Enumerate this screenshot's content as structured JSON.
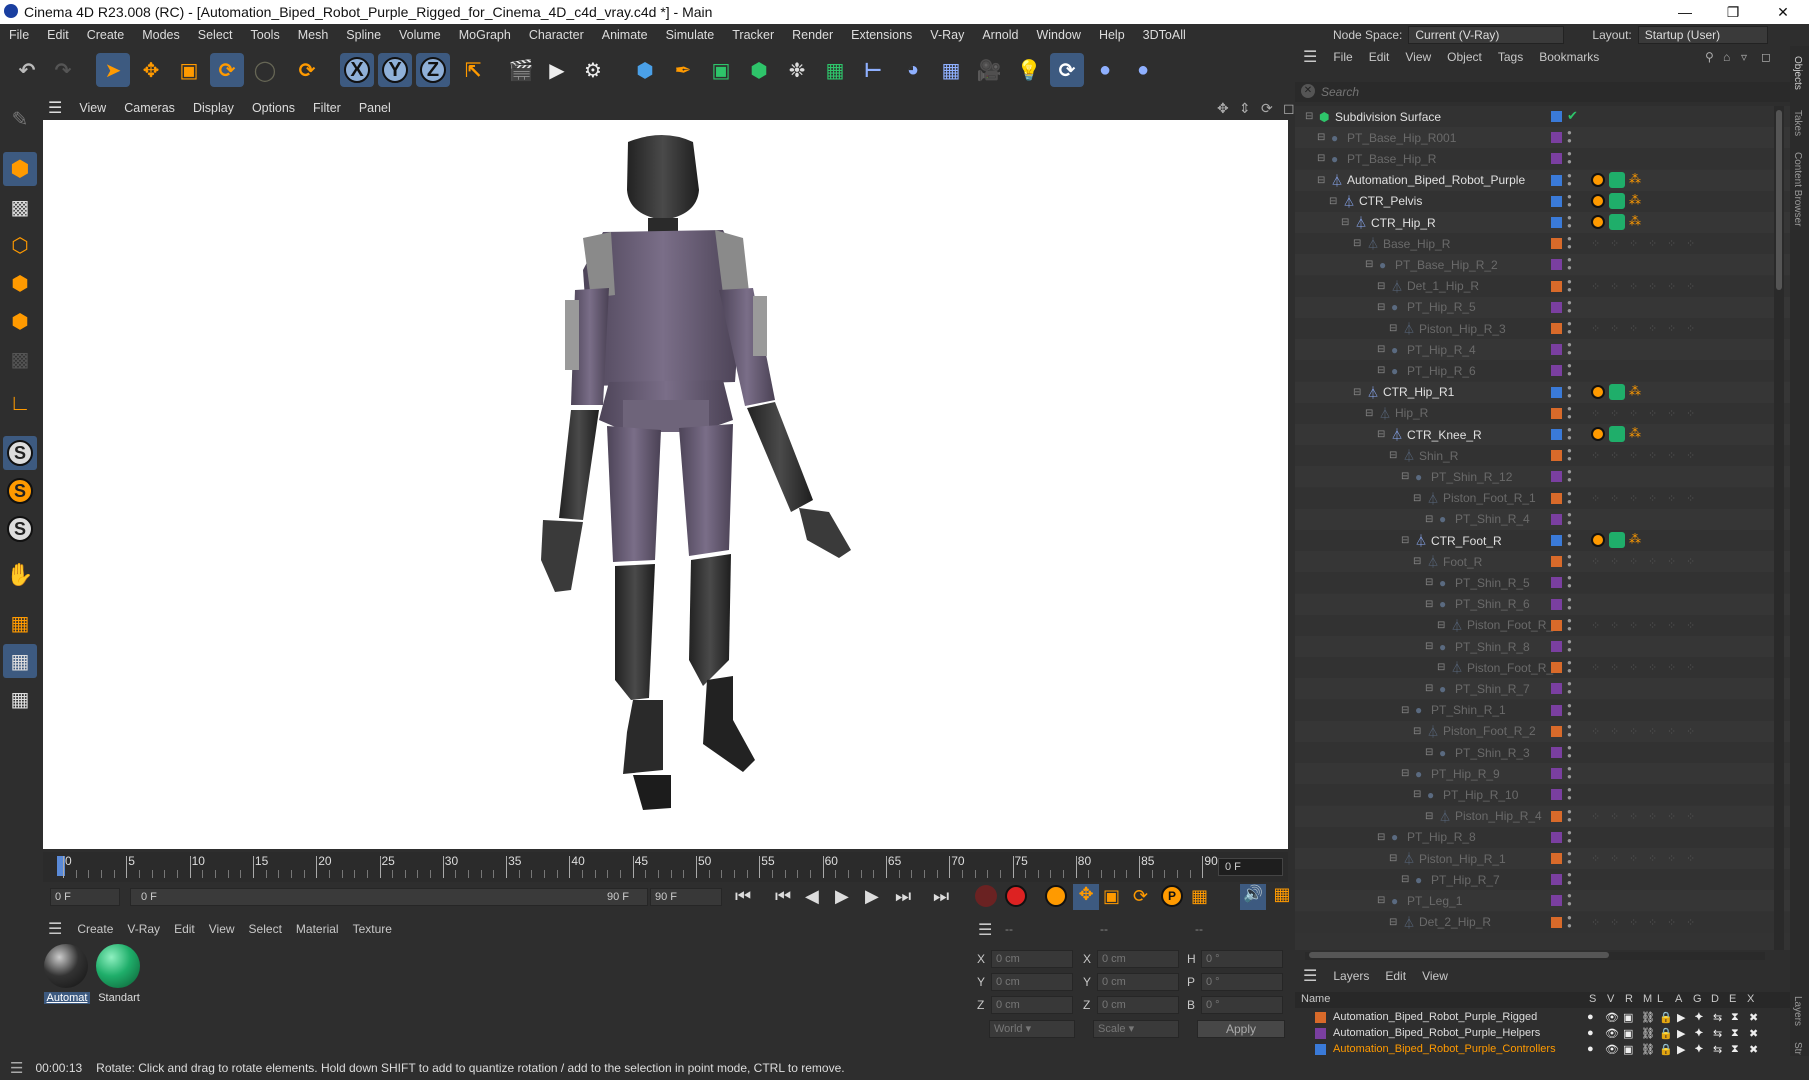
{
  "window": {
    "title": "Cinema 4D R23.008 (RC) - [Automation_Biped_Robot_Purple_Rigged_for_Cinema_4D_c4d_vray.c4d *] - Main"
  },
  "menu": [
    "File",
    "Edit",
    "Create",
    "Modes",
    "Select",
    "Tools",
    "Mesh",
    "Spline",
    "Volume",
    "MoGraph",
    "Character",
    "Animate",
    "Simulate",
    "Tracker",
    "Render",
    "Extensions",
    "V-Ray",
    "Arnold",
    "Window",
    "Help",
    "3DToAll"
  ],
  "node_space": {
    "label": "Node Space:",
    "value": "Current (V-Ray)"
  },
  "layout": {
    "label": "Layout:",
    "value": "Startup (User)"
  },
  "toolbar_axes": [
    "X",
    "Y",
    "Z"
  ],
  "viewport_menu": [
    "View",
    "Cameras",
    "Display",
    "Options",
    "Filter",
    "Panel"
  ],
  "timeline": {
    "ticks": [
      "0",
      "5",
      "10",
      "15",
      "20",
      "25",
      "30",
      "35",
      "40",
      "45",
      "50",
      "55",
      "60",
      "65",
      "70",
      "75",
      "80",
      "85",
      "90"
    ],
    "current_frame": "0 F"
  },
  "transport": {
    "start": "0 F",
    "range_start": "0 F",
    "range_end": "90 F",
    "end": "90 F"
  },
  "material_menu": [
    "Create",
    "V-Ray",
    "Edit",
    "View",
    "Select",
    "Material",
    "Texture"
  ],
  "materials": [
    {
      "name": "Automat",
      "color": "#444444"
    },
    {
      "name": "Standart",
      "color": "#1fae6a"
    }
  ],
  "coords": {
    "header": [
      "--",
      "--",
      "--"
    ],
    "rows": [
      {
        "a": "X",
        "av": "0 cm",
        "b": "X",
        "bv": "0 cm",
        "c": "H",
        "cv": "0 °"
      },
      {
        "a": "Y",
        "av": "0 cm",
        "b": "Y",
        "bv": "0 cm",
        "c": "P",
        "cv": "0 °"
      },
      {
        "a": "Z",
        "av": "0 cm",
        "b": "Z",
        "bv": "0 cm",
        "c": "B",
        "cv": "0 °"
      }
    ],
    "space": "World",
    "mode": "Scale",
    "apply": "Apply"
  },
  "objects_menu": [
    "File",
    "Edit",
    "View",
    "Object",
    "Tags",
    "Bookmarks"
  ],
  "search_placeholder": "Search",
  "objects": [
    {
      "name": "Subdivision Surface",
      "depth": 0,
      "hidden": false,
      "type": "subd"
    },
    {
      "name": "PT_Base_Hip_R001",
      "depth": 1,
      "hidden": true,
      "type": "null"
    },
    {
      "name": "PT_Base_Hip_R",
      "depth": 1,
      "hidden": true,
      "type": "null"
    },
    {
      "name": "Automation_Biped_Robot_Purple",
      "depth": 1,
      "hidden": false,
      "type": "joint",
      "tags": true
    },
    {
      "name": "CTR_Pelvis",
      "depth": 2,
      "hidden": false,
      "type": "joint",
      "tags": true
    },
    {
      "name": "CTR_Hip_R",
      "depth": 3,
      "hidden": false,
      "type": "joint",
      "tags": true
    },
    {
      "name": "Base_Hip_R",
      "depth": 4,
      "hidden": true,
      "type": "joint"
    },
    {
      "name": "PT_Base_Hip_R_2",
      "depth": 5,
      "hidden": true,
      "type": "null"
    },
    {
      "name": "Det_1_Hip_R",
      "depth": 6,
      "hidden": true,
      "type": "joint"
    },
    {
      "name": "PT_Hip_R_5",
      "depth": 6,
      "hidden": true,
      "type": "null"
    },
    {
      "name": "Piston_Hip_R_3",
      "depth": 7,
      "hidden": true,
      "type": "joint"
    },
    {
      "name": "PT_Hip_R_4",
      "depth": 6,
      "hidden": true,
      "type": "null"
    },
    {
      "name": "PT_Hip_R_6",
      "depth": 6,
      "hidden": true,
      "type": "null"
    },
    {
      "name": "CTR_Hip_R1",
      "depth": 4,
      "hidden": false,
      "type": "joint",
      "tags": true
    },
    {
      "name": "Hip_R",
      "depth": 5,
      "hidden": true,
      "type": "joint"
    },
    {
      "name": "CTR_Knee_R",
      "depth": 6,
      "hidden": false,
      "type": "joint",
      "tags": true
    },
    {
      "name": "Shin_R",
      "depth": 7,
      "hidden": true,
      "type": "joint"
    },
    {
      "name": "PT_Shin_R_12",
      "depth": 8,
      "hidden": true,
      "type": "null"
    },
    {
      "name": "Piston_Foot_R_1",
      "depth": 9,
      "hidden": true,
      "type": "joint"
    },
    {
      "name": "PT_Shin_R_4",
      "depth": 10,
      "hidden": true,
      "type": "null"
    },
    {
      "name": "CTR_Foot_R",
      "depth": 8,
      "hidden": false,
      "type": "joint",
      "tags": true
    },
    {
      "name": "Foot_R",
      "depth": 9,
      "hidden": true,
      "type": "joint"
    },
    {
      "name": "PT_Shin_R_5",
      "depth": 10,
      "hidden": true,
      "type": "null"
    },
    {
      "name": "PT_Shin_R_6",
      "depth": 10,
      "hidden": true,
      "type": "null"
    },
    {
      "name": "Piston_Foot_R_3",
      "depth": 11,
      "hidden": true,
      "type": "joint"
    },
    {
      "name": "PT_Shin_R_8",
      "depth": 10,
      "hidden": true,
      "type": "null"
    },
    {
      "name": "Piston_Foot_R_4",
      "depth": 11,
      "hidden": true,
      "type": "joint"
    },
    {
      "name": "PT_Shin_R_7",
      "depth": 10,
      "hidden": true,
      "type": "null"
    },
    {
      "name": "PT_Shin_R_1",
      "depth": 8,
      "hidden": true,
      "type": "null"
    },
    {
      "name": "Piston_Foot_R_2",
      "depth": 9,
      "hidden": true,
      "type": "joint"
    },
    {
      "name": "PT_Shin_R_3",
      "depth": 10,
      "hidden": true,
      "type": "null"
    },
    {
      "name": "PT_Hip_R_9",
      "depth": 8,
      "hidden": true,
      "type": "null"
    },
    {
      "name": "PT_Hip_R_10",
      "depth": 9,
      "hidden": true,
      "type": "null"
    },
    {
      "name": "Piston_Hip_R_4",
      "depth": 10,
      "hidden": true,
      "type": "joint"
    },
    {
      "name": "PT_Hip_R_8",
      "depth": 6,
      "hidden": true,
      "type": "null"
    },
    {
      "name": "Piston_Hip_R_1",
      "depth": 7,
      "hidden": true,
      "type": "joint"
    },
    {
      "name": "PT_Hip_R_7",
      "depth": 8,
      "hidden": true,
      "type": "null"
    },
    {
      "name": "PT_Leg_1",
      "depth": 6,
      "hidden": true,
      "type": "null"
    },
    {
      "name": "Det_2_Hip_R",
      "depth": 7,
      "hidden": true,
      "type": "joint"
    }
  ],
  "layers_menu": [
    "Layers",
    "Edit",
    "View"
  ],
  "layers_header": {
    "name": "Name",
    "cols": [
      "S",
      "V",
      "R",
      "M",
      "L",
      "A",
      "G",
      "D",
      "E",
      "X"
    ]
  },
  "layers": [
    {
      "name": "Automation_Biped_Robot_Purple_Rigged",
      "color": "#d86a2a",
      "active": false
    },
    {
      "name": "Automation_Biped_Robot_Purple_Helpers",
      "color": "#7a3fa0",
      "active": false
    },
    {
      "name": "Automation_Biped_Robot_Purple_Controllers",
      "color": "#3a7ad8",
      "active": true
    }
  ],
  "side_tabs": [
    "Objects",
    "Takes",
    "Content Browser",
    "Layers",
    "Str"
  ],
  "status": {
    "time": "00:00:13",
    "message": "Rotate: Click and drag to rotate elements. Hold down SHIFT to add to quantize rotation / add to the selection in point mode, CTRL to remove."
  }
}
